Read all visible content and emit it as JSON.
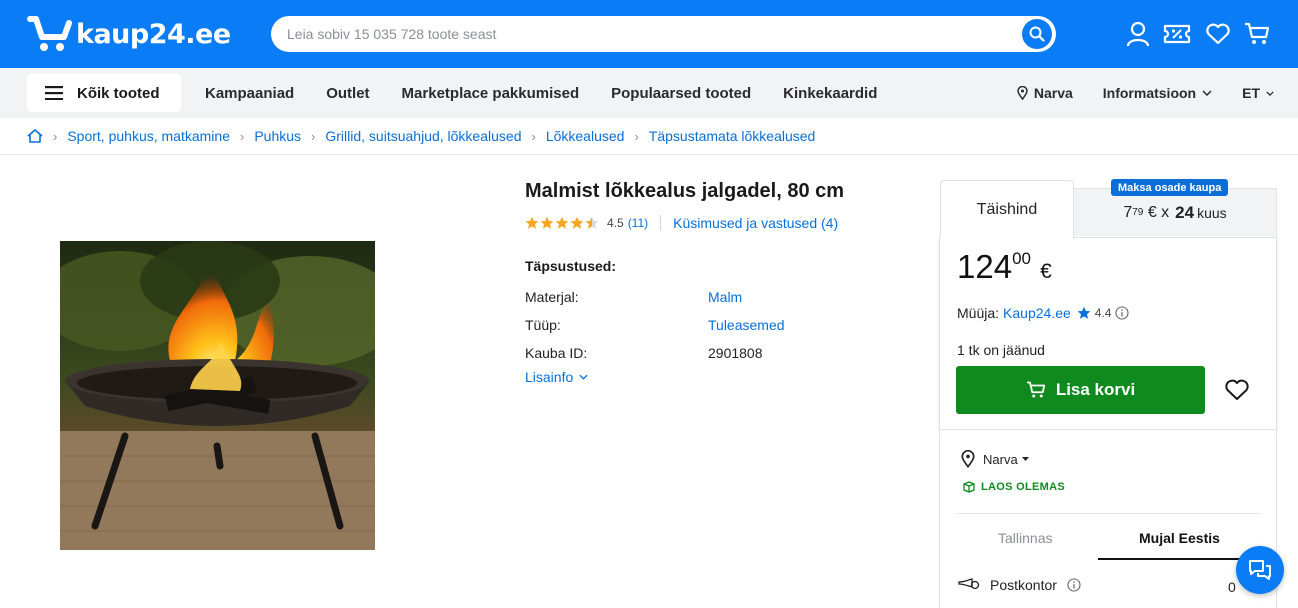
{
  "header": {
    "logo_text": "kaup24.ee",
    "search_placeholder": "Leia sobiv 15 035 728 toote seast",
    "icons": [
      "user-icon",
      "discount-icon",
      "heart-icon",
      "cart-icon"
    ]
  },
  "nav": {
    "all_products": "Kõik tooted",
    "links": [
      "Kampaaniad",
      "Outlet",
      "Marketplace pakkumised",
      "Populaarsed tooted",
      "Kinkekaardid"
    ],
    "location": "Narva",
    "info": "Informatsioon",
    "lang": "ET"
  },
  "breadcrumb": [
    "Sport, puhkus, matkamine",
    "Puhkus",
    "Grillid, suitsuahjud, lõkkealused",
    "Lõkkealused",
    "Täpsustamata lõkkealused"
  ],
  "product": {
    "title": "Malmist lõkkealus jalgadel, 80 cm",
    "rating": "4.5",
    "rating_value": 4.5,
    "reviews": "(11)",
    "qa": "Küsimused ja vastused (4)",
    "specs_heading": "Täpsustused:",
    "specs": [
      {
        "label": "Materjal:",
        "value": "Malm"
      },
      {
        "label": "Tüüp:",
        "value": "Tuleasemed"
      },
      {
        "label": "Kauba ID:",
        "value": "2901808"
      }
    ],
    "more_info": "Lisainfo"
  },
  "buybox": {
    "tab_full": "Täishind",
    "tab_installment_badge": "Maksa osade kaupa",
    "installment_int": "7",
    "installment_dec": "79",
    "installment_cur": "€ x",
    "installment_months": "24",
    "installment_unit": "kuus",
    "price_int": "124",
    "price_dec": "00",
    "currency": "€",
    "seller_label": "Müüja:",
    "seller_name": "Kaup24.ee",
    "seller_rating": "4.4",
    "stock": "1 tk on jäänud",
    "cart_button": "Lisa korvi"
  },
  "delivery": {
    "location": "Narva",
    "in_stock": "LAOS OLEMAS",
    "tab_a": "Tallinnas",
    "tab_b": "Mujal Eestis",
    "method": "Postkontor",
    "price": "0"
  },
  "colors": {
    "brand": "#0a7cf5",
    "link": "#0a6fd8",
    "cart": "#0f8a1f",
    "star": "#f5a623"
  }
}
